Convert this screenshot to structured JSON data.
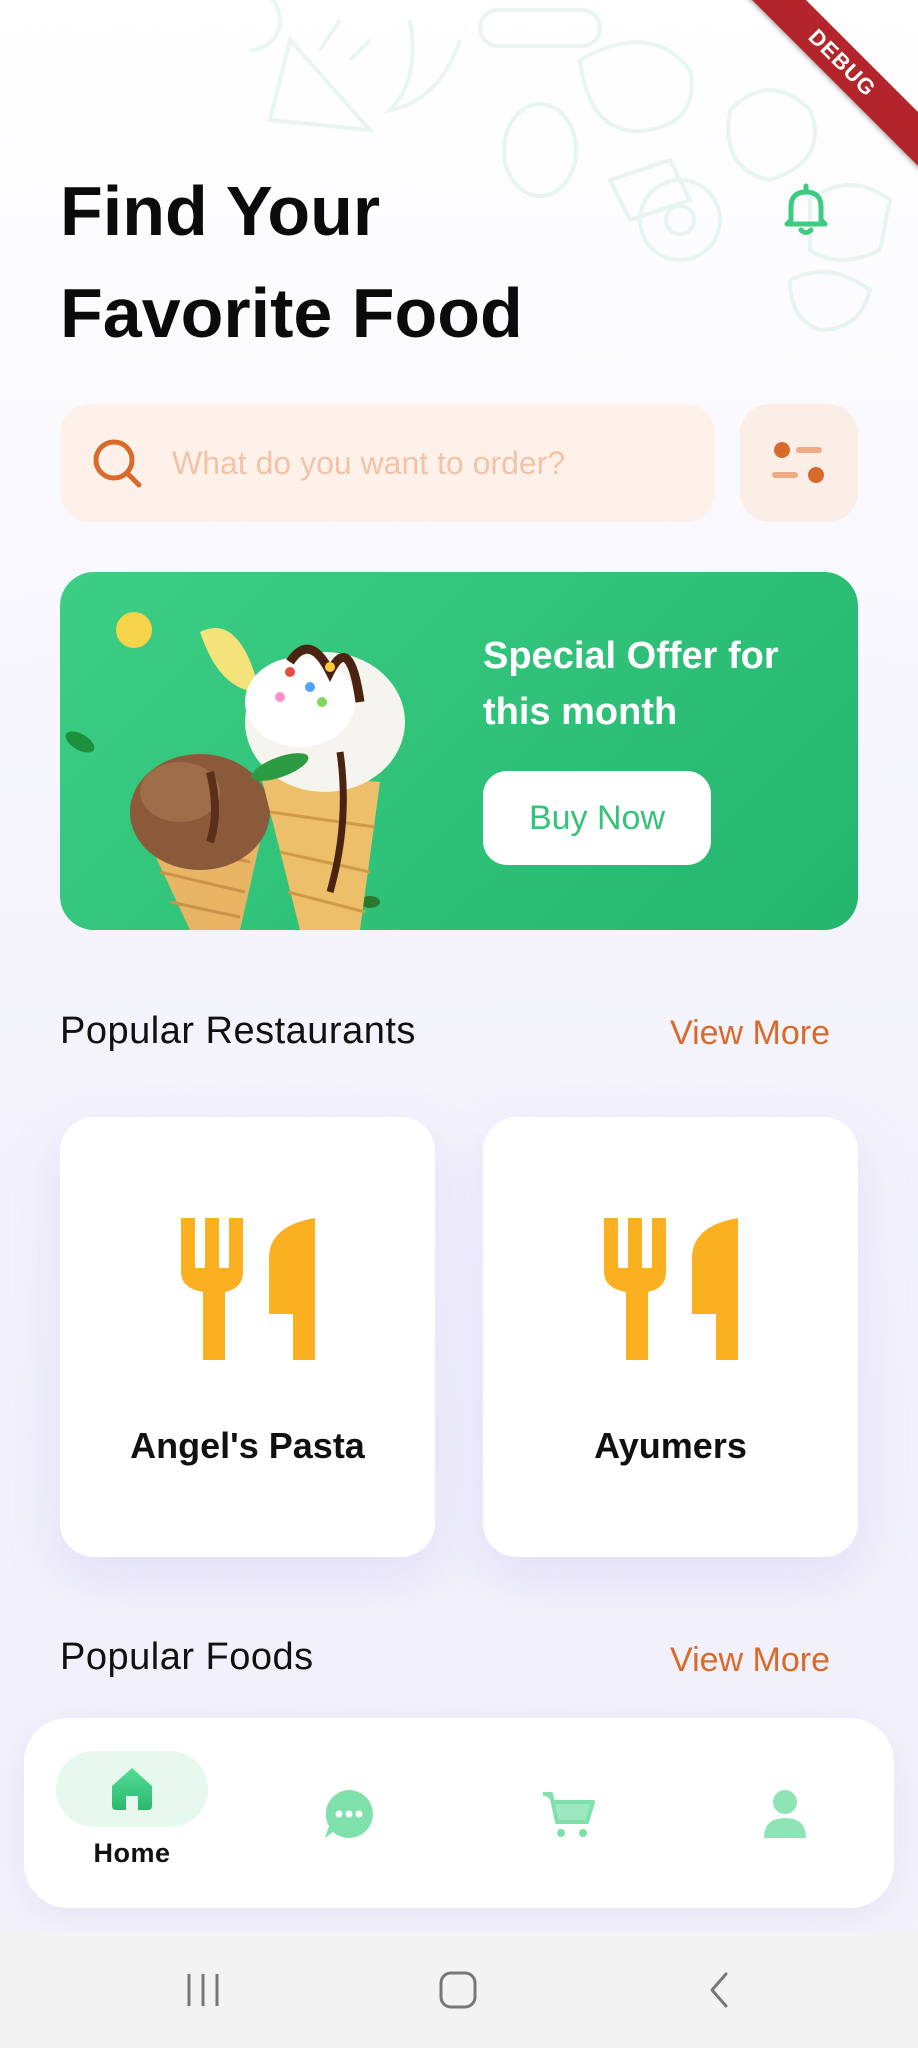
{
  "debug_badge": "DEBUG",
  "header": {
    "title_line1": "Find Your",
    "title_line2": "Favorite Food"
  },
  "search": {
    "placeholder": "What do you want to order?"
  },
  "banner": {
    "offer_text": "Special Offer for this month",
    "button_label": "Buy Now"
  },
  "restaurants_section": {
    "title": "Popular Restaurants",
    "view_more": "View More",
    "items": [
      {
        "name": "Angel's Pasta"
      },
      {
        "name": "Ayumers"
      }
    ]
  },
  "foods_section": {
    "title": "Popular Foods",
    "view_more": "View More"
  },
  "bottom_nav": {
    "active_label": "Home",
    "items": [
      "home-icon",
      "chat-icon",
      "cart-icon",
      "profile-icon"
    ]
  },
  "colors": {
    "accent_green": "#3DCB82",
    "accent_orange": "#D86A2B",
    "utensil_orange": "#FBB022",
    "debug_red": "#B3252A"
  }
}
